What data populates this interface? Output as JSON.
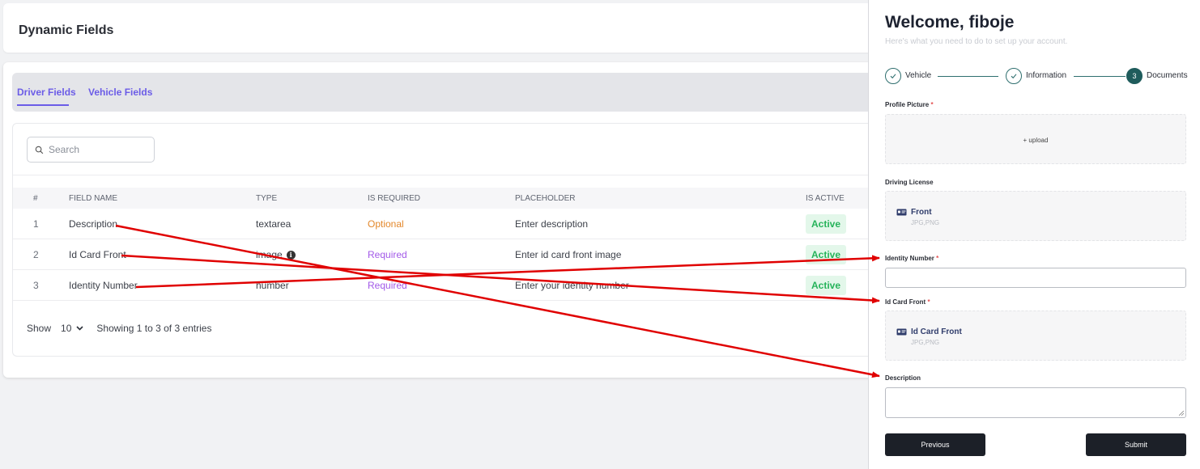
{
  "page": {
    "title": "Dynamic Fields"
  },
  "tabs": [
    {
      "label": "Driver Fields",
      "active": true
    },
    {
      "label": "Vehicle Fields",
      "active": false
    }
  ],
  "search": {
    "placeholder": "Search",
    "icon": "search-icon"
  },
  "table": {
    "headers": [
      "#",
      "FIELD NAME",
      "TYPE",
      "IS REQUIRED",
      "PLACEHOLDER",
      "IS ACTIVE"
    ],
    "rows": [
      {
        "num": "1",
        "name": "Description",
        "type": "textarea",
        "required": "Optional",
        "placeholder": "Enter description",
        "active": "Active"
      },
      {
        "num": "2",
        "name": "Id Card Front",
        "type": "image",
        "required": "Required",
        "placeholder": "Enter id card front image",
        "active": "Active"
      },
      {
        "num": "3",
        "name": "Identity Number",
        "type": "number",
        "required": "Required",
        "placeholder": "Enter your identity number",
        "active": "Active"
      }
    ]
  },
  "footer": {
    "show_label": "Show",
    "page_size": "10",
    "entries_text": "Showing 1 to 3 of 3 entries"
  },
  "panel": {
    "title": "Welcome, fiboje",
    "subtitle": "Here's what you need to do to set up your account.",
    "steps": [
      {
        "label": "Vehicle",
        "state": "done"
      },
      {
        "label": "Information",
        "state": "done"
      },
      {
        "label": "Documents",
        "number": "3",
        "state": "current"
      }
    ],
    "profile_picture": {
      "label": "Profile Picture",
      "star": "*",
      "upload_text": "+ upload"
    },
    "driving_license": {
      "label": "Driving License",
      "doc_title": "Front",
      "doc_sub": "JPG,PNG"
    },
    "identity_number": {
      "label": "Identity Number",
      "star": "*"
    },
    "id_card_front": {
      "label": "Id Card Front",
      "star": "*",
      "doc_title": "Id Card Front",
      "doc_sub": "JPG,PNG"
    },
    "description": {
      "label": "Description"
    },
    "buttons": {
      "previous": "Previous",
      "submit": "Submit"
    }
  },
  "colors": {
    "accent": "#6b5ce7",
    "optional": "#e3872a",
    "required": "#a259e8",
    "active_bg": "#e3f7ea",
    "active_text": "#26b35a",
    "step": "#1f5c5c",
    "arrow": "#e00000"
  }
}
